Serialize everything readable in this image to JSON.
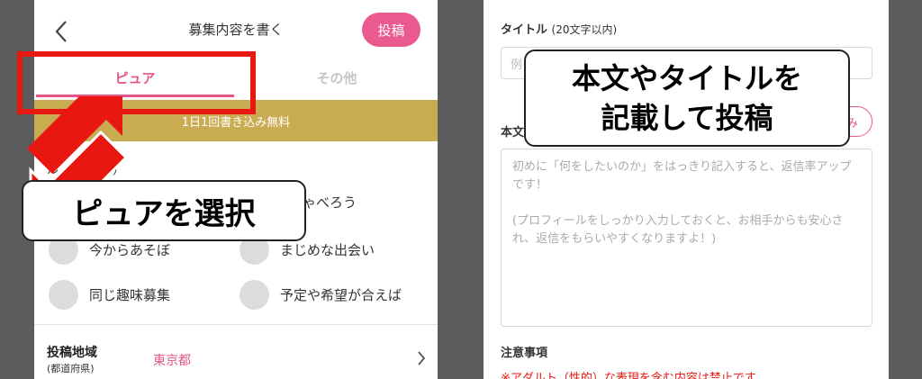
{
  "left_screen": {
    "header": {
      "title": "募集内容を書く",
      "post_button": "投稿"
    },
    "tabs": [
      {
        "label": "ピュア",
        "selected": true
      },
      {
        "label": "その他",
        "selected": false
      }
    ],
    "banner": "1日1回書き込み無料",
    "section_label": "ル（1つのみ）",
    "options": [
      {
        "label": "くしゃべろう"
      },
      {
        "label": "今からあそぼ"
      },
      {
        "label": "まじめな出会い"
      },
      {
        "label": "同じ趣味募集"
      },
      {
        "label": "予定や希望が合えば"
      }
    ],
    "region": {
      "label": "投稿地域",
      "sublabel": "(都道府県)",
      "value": "東京都"
    }
  },
  "right_screen": {
    "title_label": "タイトル",
    "title_hint": "(20文字以内)",
    "title_placeholder": "例",
    "body_label": "本文",
    "template_button": "み",
    "body_placeholder": {
      "line1": "初めに「何をしたいのか」をはっきり記入すると、返信率アップです！",
      "line2": "(プロフィールをしっかり入力しておくと、お相手からも安心され、返信をもらいやすくなりますよ！)"
    },
    "notes_label": "注意事項",
    "warning": "※アダルト（性的）な表現を含む内容は禁止です"
  },
  "annotations": {
    "left_callout": "ピュアを選択",
    "right_callout_line1": "本文やタイトルを",
    "right_callout_line2": "記載して投稿",
    "highlight_color": "#e8170f"
  },
  "colors": {
    "accent_pink": "#ea5a8f",
    "banner_gold": "#c9ab52",
    "backdrop_gray": "#5c5c5c"
  },
  "icons": [
    "back-chevron-icon",
    "chevron-right-icon"
  ]
}
